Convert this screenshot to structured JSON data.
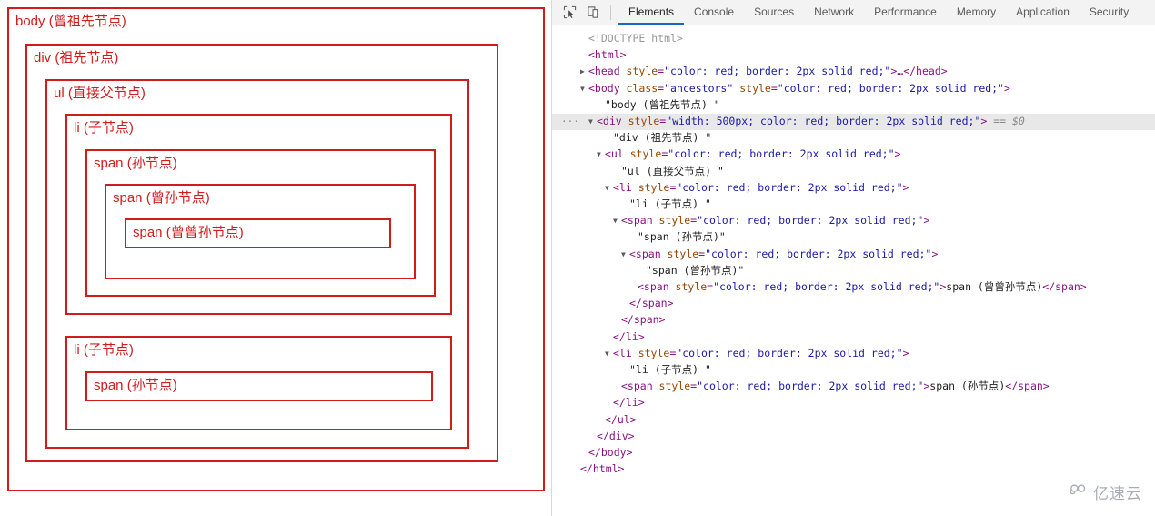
{
  "page_pane": {
    "nodes": {
      "body": {
        "label": "body (曾祖先节点)"
      },
      "div": {
        "label": "div (祖先节点)"
      },
      "ul": {
        "label": "ul (直接父节点)"
      },
      "li1": {
        "label": "li (子节点)"
      },
      "span1": {
        "label": "span (孙节点)"
      },
      "span2": {
        "label": "span (曾孙节点)"
      },
      "span3": {
        "label": "span (曾曾孙节点)"
      },
      "li2": {
        "label": "li (子节点)"
      },
      "span4": {
        "label": "span (孙节点)"
      }
    },
    "border_color": "#d11c1c",
    "text_color": "#d11c1c"
  },
  "devtools": {
    "toolbar": {
      "inspect_icon": "inspect-element-icon",
      "device_icon": "device-toolbar-icon"
    },
    "tabs": [
      {
        "label": "Elements",
        "active": true
      },
      {
        "label": "Console",
        "active": false
      },
      {
        "label": "Sources",
        "active": false
      },
      {
        "label": "Network",
        "active": false
      },
      {
        "label": "Performance",
        "active": false
      },
      {
        "label": "Memory",
        "active": false
      },
      {
        "label": "Application",
        "active": false
      },
      {
        "label": "Security",
        "active": false
      }
    ],
    "active_tab_underline_color": "#1668c4",
    "selected_row_background": "#e8e8e8",
    "dom_rows": [
      {
        "indent": 1,
        "gutter": "",
        "triangle": "",
        "selected": false,
        "parts": [
          {
            "t": "<!DOCTYPE html>",
            "c": "c-gray"
          }
        ]
      },
      {
        "indent": 1,
        "gutter": "",
        "triangle": "",
        "selected": false,
        "parts": [
          {
            "t": "<html>",
            "c": "c-tag"
          }
        ]
      },
      {
        "indent": 1,
        "gutter": "",
        "triangle": "▶",
        "selected": false,
        "parts": [
          {
            "t": "<head ",
            "c": "c-tag"
          },
          {
            "t": "style",
            "c": "c-attr"
          },
          {
            "t": "=",
            "c": "c-tag"
          },
          {
            "t": "\"color: red; border: 2px solid red;\"",
            "c": "c-val"
          },
          {
            "t": ">…</head>",
            "c": "c-tag"
          }
        ]
      },
      {
        "indent": 1,
        "gutter": "",
        "triangle": "▼",
        "selected": false,
        "parts": [
          {
            "t": "<body ",
            "c": "c-tag"
          },
          {
            "t": "class",
            "c": "c-attr"
          },
          {
            "t": "=",
            "c": "c-tag"
          },
          {
            "t": "\"ancestors\"",
            "c": "c-val"
          },
          {
            "t": " ",
            "c": "c-tag"
          },
          {
            "t": "style",
            "c": "c-attr"
          },
          {
            "t": "=",
            "c": "c-tag"
          },
          {
            "t": "\"color: red; border: 2px solid red;\"",
            "c": "c-val"
          },
          {
            "t": ">",
            "c": "c-tag"
          }
        ]
      },
      {
        "indent": 3,
        "gutter": "",
        "triangle": "",
        "selected": false,
        "parts": [
          {
            "t": "\"body (曾祖先节点) \"",
            "c": "c-text"
          }
        ]
      },
      {
        "indent": 2,
        "gutter": "···",
        "triangle": "▼",
        "selected": true,
        "parts": [
          {
            "t": "<div ",
            "c": "c-tag"
          },
          {
            "t": "style",
            "c": "c-attr"
          },
          {
            "t": "=",
            "c": "c-tag"
          },
          {
            "t": "\"width: 500px; color: red; border: 2px solid red;\"",
            "c": "c-val"
          },
          {
            "t": ">",
            "c": "c-tag"
          },
          {
            "t": " == $0",
            "c": "c-ref"
          }
        ]
      },
      {
        "indent": 4,
        "gutter": "",
        "triangle": "",
        "selected": false,
        "parts": [
          {
            "t": "\"div (祖先节点) \"",
            "c": "c-text"
          }
        ]
      },
      {
        "indent": 3,
        "gutter": "",
        "triangle": "▼",
        "selected": false,
        "parts": [
          {
            "t": "<ul ",
            "c": "c-tag"
          },
          {
            "t": "style",
            "c": "c-attr"
          },
          {
            "t": "=",
            "c": "c-tag"
          },
          {
            "t": "\"color: red; border: 2px solid red;\"",
            "c": "c-val"
          },
          {
            "t": ">",
            "c": "c-tag"
          }
        ]
      },
      {
        "indent": 5,
        "gutter": "",
        "triangle": "",
        "selected": false,
        "parts": [
          {
            "t": "\"ul (直接父节点) \"",
            "c": "c-text"
          }
        ]
      },
      {
        "indent": 4,
        "gutter": "",
        "triangle": "▼",
        "selected": false,
        "parts": [
          {
            "t": "<li ",
            "c": "c-tag"
          },
          {
            "t": "style",
            "c": "c-attr"
          },
          {
            "t": "=",
            "c": "c-tag"
          },
          {
            "t": "\"color: red; border: 2px solid red;\"",
            "c": "c-val"
          },
          {
            "t": ">",
            "c": "c-tag"
          }
        ]
      },
      {
        "indent": 6,
        "gutter": "",
        "triangle": "",
        "selected": false,
        "parts": [
          {
            "t": "\"li (子节点) \"",
            "c": "c-text"
          }
        ]
      },
      {
        "indent": 5,
        "gutter": "",
        "triangle": "▼",
        "selected": false,
        "parts": [
          {
            "t": "<span ",
            "c": "c-tag"
          },
          {
            "t": "style",
            "c": "c-attr"
          },
          {
            "t": "=",
            "c": "c-tag"
          },
          {
            "t": "\"color: red; border: 2px solid red;\"",
            "c": "c-val"
          },
          {
            "t": ">",
            "c": "c-tag"
          }
        ]
      },
      {
        "indent": 7,
        "gutter": "",
        "triangle": "",
        "selected": false,
        "parts": [
          {
            "t": "\"span (孙节点)\"",
            "c": "c-text"
          }
        ]
      },
      {
        "indent": 6,
        "gutter": "",
        "triangle": "▼",
        "selected": false,
        "parts": [
          {
            "t": "<span ",
            "c": "c-tag"
          },
          {
            "t": "style",
            "c": "c-attr"
          },
          {
            "t": "=",
            "c": "c-tag"
          },
          {
            "t": "\"color: red; border: 2px solid red;\"",
            "c": "c-val"
          },
          {
            "t": ">",
            "c": "c-tag"
          }
        ]
      },
      {
        "indent": 8,
        "gutter": "",
        "triangle": "",
        "selected": false,
        "parts": [
          {
            "t": "\"span (曾孙节点)\"",
            "c": "c-text"
          }
        ]
      },
      {
        "indent": 7,
        "gutter": "",
        "triangle": "",
        "selected": false,
        "parts": [
          {
            "t": "<span ",
            "c": "c-tag"
          },
          {
            "t": "style",
            "c": "c-attr"
          },
          {
            "t": "=",
            "c": "c-tag"
          },
          {
            "t": "\"color: red; border: 2px solid red;\"",
            "c": "c-val"
          },
          {
            "t": ">",
            "c": "c-tag"
          },
          {
            "t": "span (曾曾孙节点)",
            "c": "c-text"
          },
          {
            "t": "</span>",
            "c": "c-tag"
          }
        ]
      },
      {
        "indent": 6,
        "gutter": "",
        "triangle": "",
        "selected": false,
        "parts": [
          {
            "t": "</span>",
            "c": "c-tag"
          }
        ]
      },
      {
        "indent": 5,
        "gutter": "",
        "triangle": "",
        "selected": false,
        "parts": [
          {
            "t": "</span>",
            "c": "c-tag"
          }
        ]
      },
      {
        "indent": 4,
        "gutter": "",
        "triangle": "",
        "selected": false,
        "parts": [
          {
            "t": "</li>",
            "c": "c-tag"
          }
        ]
      },
      {
        "indent": 4,
        "gutter": "",
        "triangle": "▼",
        "selected": false,
        "parts": [
          {
            "t": "<li ",
            "c": "c-tag"
          },
          {
            "t": "style",
            "c": "c-attr"
          },
          {
            "t": "=",
            "c": "c-tag"
          },
          {
            "t": "\"color: red; border: 2px solid red;\"",
            "c": "c-val"
          },
          {
            "t": ">",
            "c": "c-tag"
          }
        ]
      },
      {
        "indent": 6,
        "gutter": "",
        "triangle": "",
        "selected": false,
        "parts": [
          {
            "t": "\"li (子节点) \"",
            "c": "c-text"
          }
        ]
      },
      {
        "indent": 5,
        "gutter": "",
        "triangle": "",
        "selected": false,
        "parts": [
          {
            "t": "<span ",
            "c": "c-tag"
          },
          {
            "t": "style",
            "c": "c-attr"
          },
          {
            "t": "=",
            "c": "c-tag"
          },
          {
            "t": "\"color: red; border: 2px solid red;\"",
            "c": "c-val"
          },
          {
            "t": ">",
            "c": "c-tag"
          },
          {
            "t": "span (孙节点)",
            "c": "c-text"
          },
          {
            "t": "</span>",
            "c": "c-tag"
          }
        ]
      },
      {
        "indent": 4,
        "gutter": "",
        "triangle": "",
        "selected": false,
        "parts": [
          {
            "t": "</li>",
            "c": "c-tag"
          }
        ]
      },
      {
        "indent": 3,
        "gutter": "",
        "triangle": "",
        "selected": false,
        "parts": [
          {
            "t": "</ul>",
            "c": "c-tag"
          }
        ]
      },
      {
        "indent": 2,
        "gutter": "",
        "triangle": "",
        "selected": false,
        "parts": [
          {
            "t": "</div>",
            "c": "c-tag"
          }
        ]
      },
      {
        "indent": 1,
        "gutter": "",
        "triangle": "",
        "selected": false,
        "parts": [
          {
            "t": "</body>",
            "c": "c-tag"
          }
        ]
      },
      {
        "indent": 0,
        "gutter": "",
        "triangle": "",
        "selected": false,
        "parts": [
          {
            "t": "</html>",
            "c": "c-tag"
          }
        ]
      }
    ]
  },
  "watermark": {
    "text": "亿速云",
    "logo_icon": "cloud-logo-icon",
    "color": "#a8adb5"
  }
}
